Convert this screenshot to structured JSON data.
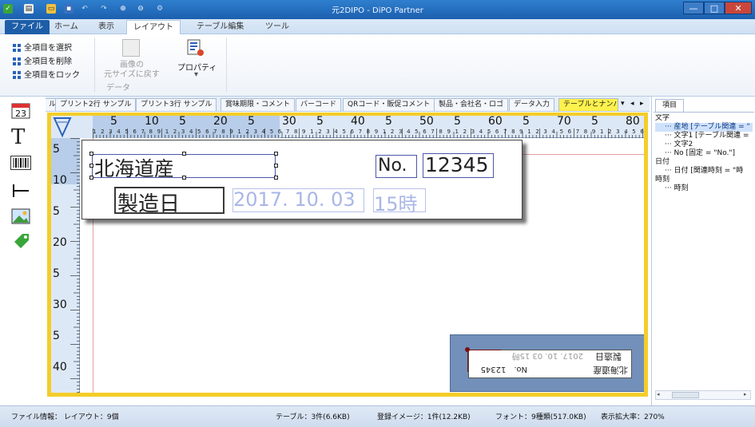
{
  "window": {
    "title": "元2DIPO - DiPO Partner",
    "minimize": "—",
    "maximize": "□",
    "close": "✕"
  },
  "menu": {
    "tabs": [
      "ファイル",
      "ホーム",
      "表示",
      "レイアウト",
      "テーブル編集",
      "ツール"
    ],
    "active": "レイアウト"
  },
  "ribbon": {
    "select_all": "全項目を選択",
    "delete_all": "全項目を削除",
    "lock_all": "全項目をロック",
    "restore_size_line1": "画像の",
    "restore_size_line2": "元サイズに戻す",
    "group_data": "データ",
    "properties": "プロパティ",
    "properties_sub": "▾"
  },
  "doc_tabs": [
    "ル",
    "プリント2行 サンプル",
    "プリント3行 サンプル",
    "賞味期限・コメント",
    "バーコード",
    "QRコード・販促コメント",
    "製品・会社名・ロゴ",
    "データ入力",
    "テーブルとナンバ"
  ],
  "doc_tab_active": "テーブルとナンバ",
  "doc_tab_controls": [
    "▾",
    "◂",
    "▸"
  ],
  "ruler_top": {
    "major": [
      "5",
      "10",
      "5",
      "20",
      "5",
      "30",
      "5",
      "40",
      "5",
      "50",
      "5",
      "60",
      "5",
      "70",
      "5",
      "80"
    ],
    "minor": "1 2 3 4 5 6 7 8 9 1 2 3 4 5 6 7 8 9 1 2 3 4 5 6 7 8 9 1 2 3 4 5 6 7 8 9 1 2 3 4 5 6 7 8 9 1 2 3 4 5 6 7 8 9 1 2 3 4 5 6 7 8 9 1 2 3 4 5 6 7 8 9 1 2 3 4 5 6 7 8 9 1 2"
  },
  "ruler_left": {
    "major": [
      "5",
      "10",
      "5",
      "20",
      "5",
      "30",
      "5",
      "40"
    ]
  },
  "label": {
    "origin": "北海道産",
    "no_label": "No.",
    "no_value": "12345",
    "date_label": "製造日",
    "date_value": "2017. 10. 03",
    "hour_value": "15時"
  },
  "minimap": {
    "origin": "北海道産",
    "no": "No.　12345",
    "date_label": "製造日",
    "date_value": "2017. 10. 03 15時"
  },
  "right_panel": {
    "tab": "項目",
    "tree": [
      {
        "text": "文字",
        "indent": 0,
        "selected": false
      },
      {
        "text": "産地 [テーブル関連 = \"",
        "indent": 1,
        "selected": true
      },
      {
        "text": "文字1 [テーブル関連 =",
        "indent": 1,
        "selected": false
      },
      {
        "text": "文字2",
        "indent": 1,
        "selected": false
      },
      {
        "text": "No [固定 = \"No.\"]",
        "indent": 1,
        "selected": false
      },
      {
        "text": "日付",
        "indent": 0,
        "selected": false
      },
      {
        "text": "日付 [関連時刻 = \"時",
        "indent": 1,
        "selected": false
      },
      {
        "text": "時刻",
        "indent": 0,
        "selected": false
      },
      {
        "text": "時刻",
        "indent": 1,
        "selected": false
      }
    ]
  },
  "status": {
    "file_info": "ファイル情報： レイアウト：9個",
    "table": "テーブル：3件(6.6KB)",
    "images": "登録イメージ：1件(12.2KB)",
    "fonts": "フォント：9種類(517.0KB)",
    "zoom": "表示拡大率：270%"
  },
  "colors": {
    "accent": "#1e5ea8",
    "canvas_frame": "#f4cd29",
    "active_tab": "#fff14d",
    "faded_text": "#a9b6e6"
  }
}
